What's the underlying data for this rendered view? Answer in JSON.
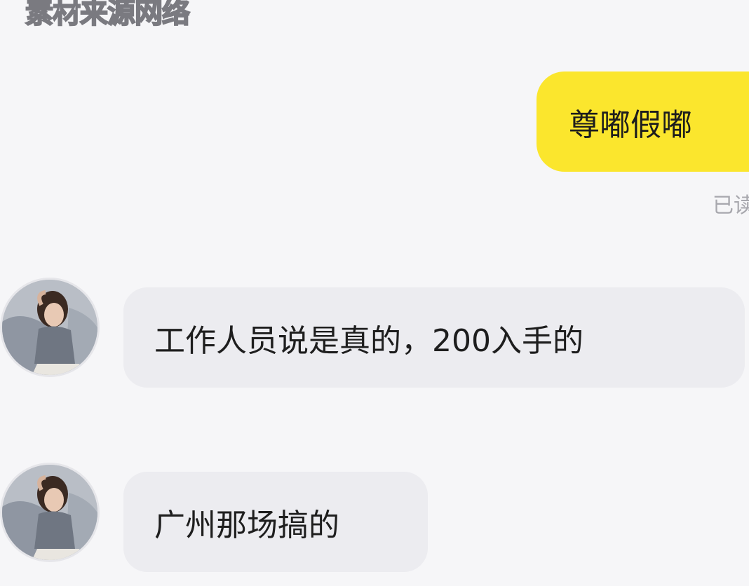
{
  "watermark": "素材来源网络",
  "messages": [
    {
      "direction": "outgoing",
      "text": "尊嘟假嘟",
      "status": "已读",
      "bubble_color": "#fbe62d"
    },
    {
      "direction": "incoming",
      "text": "工作人员说是真的，200入手的",
      "bubble_color": "#ececf0"
    },
    {
      "direction": "incoming",
      "text": "广州那场搞的",
      "bubble_color": "#ececf0"
    }
  ],
  "avatar_icon": "contact-avatar-photo"
}
